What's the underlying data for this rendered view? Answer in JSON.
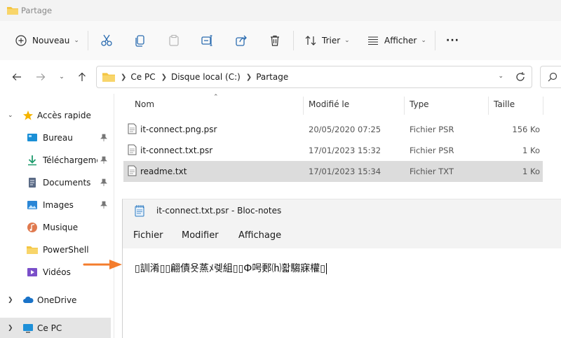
{
  "window": {
    "title": "Partage"
  },
  "toolbar": {
    "new_label": "Nouveau",
    "sort_label": "Trier",
    "view_label": "Afficher",
    "more_label": "···"
  },
  "address": {
    "crumbs": [
      "Ce PC",
      "Disque local (C:)",
      "Partage"
    ]
  },
  "sidebar": {
    "items": [
      {
        "label": "Accès rapide",
        "icon": "star-icon"
      },
      {
        "label": "Bureau",
        "icon": "desktop-icon"
      },
      {
        "label": "Téléchargements",
        "icon": "download-icon"
      },
      {
        "label": "Documents",
        "icon": "documents-icon"
      },
      {
        "label": "Images",
        "icon": "images-icon"
      },
      {
        "label": "Musique",
        "icon": "music-icon"
      },
      {
        "label": "PowerShell",
        "icon": "folder-icon"
      },
      {
        "label": "Vidéos",
        "icon": "video-icon"
      },
      {
        "label": "OneDrive",
        "icon": "cloud-icon"
      },
      {
        "label": "Ce PC",
        "icon": "pc-icon"
      }
    ]
  },
  "files": {
    "headers": {
      "name": "Nom",
      "modified": "Modifié le",
      "type": "Type",
      "size": "Taille"
    },
    "rows": [
      {
        "name": "it-connect.png.psr",
        "modified": "20/05/2020 07:25",
        "type": "Fichier PSR",
        "size": "156 Ko"
      },
      {
        "name": "it-connect.txt.psr",
        "modified": "17/01/2023 15:32",
        "type": "Fichier PSR",
        "size": "1 Ko"
      },
      {
        "name": "readme.txt",
        "modified": "17/01/2023 15:34",
        "type": "Fichier TXT",
        "size": "1 Ko"
      }
    ]
  },
  "notepad": {
    "title": "it-connect.txt.psr - Bloc-notes",
    "menu": {
      "file": "Fichier",
      "edit": "Modifier",
      "view": "Affichage"
    },
    "content": "▯訓淆▯▯翩債욧蒸ﾒ렞組▯▯Ф呺郠⒣홟騶寐權▯"
  },
  "colors": {
    "accent": "#f47c2c",
    "selection": "#dcdcdc",
    "folder": "#f4c542"
  }
}
